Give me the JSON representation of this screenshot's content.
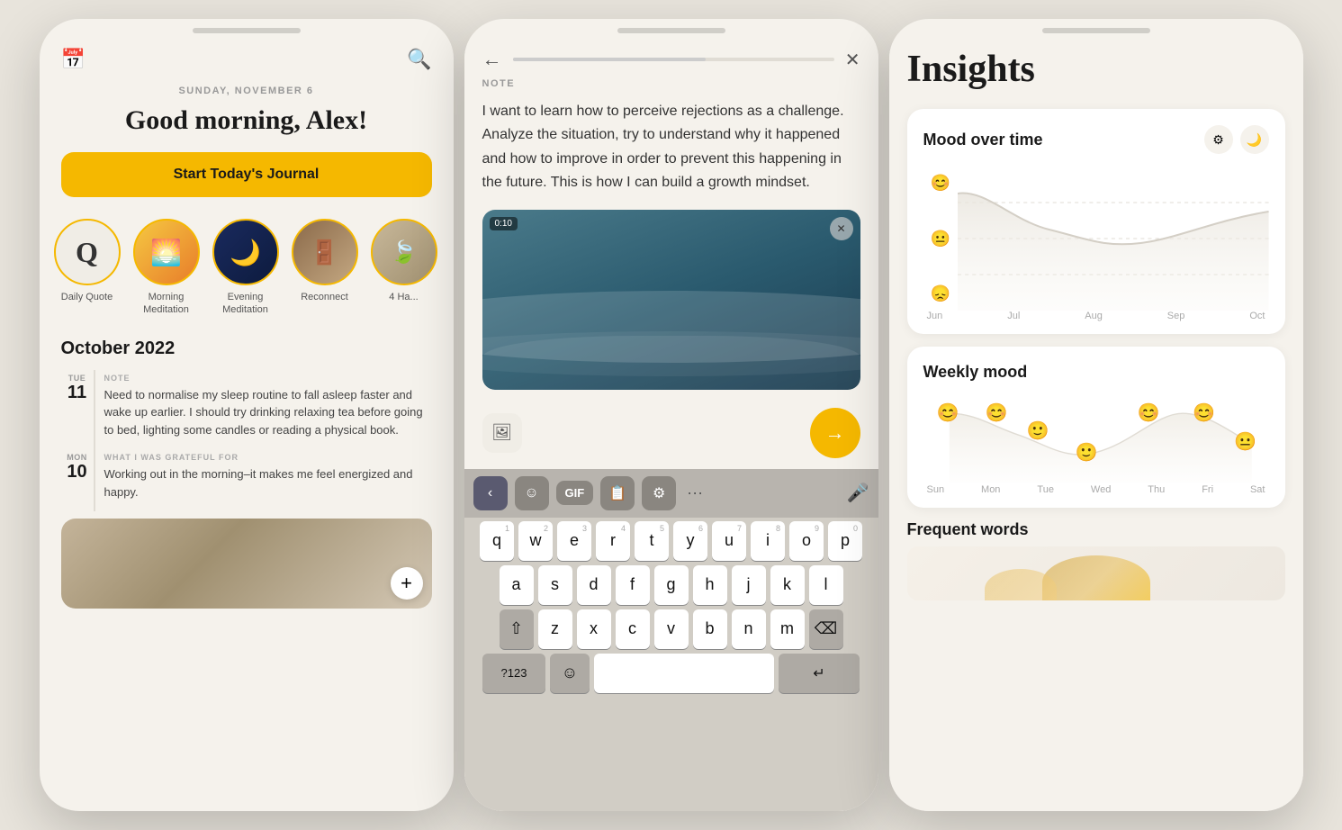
{
  "screen1": {
    "date": "SUNDAY, NOVEMBER 6",
    "greeting": "Good morning, Alex!",
    "cta_button": "Start Today's Journal",
    "circles": [
      {
        "label": "Daily Quote",
        "type": "quote"
      },
      {
        "label": "Morning Meditation",
        "type": "sunrise"
      },
      {
        "label": "Evening Meditation",
        "type": "night"
      },
      {
        "label": "Reconnect",
        "type": "door"
      },
      {
        "label": "4 Ha...",
        "type": "partial"
      }
    ],
    "section_title": "October 2022",
    "entries": [
      {
        "day_name": "TUE",
        "day_num": "11",
        "tag": "NOTE",
        "text": "Need to normalise my sleep routine to fall asleep faster and wake up earlier. I should try drinking relaxing tea before going to bed, lighting some candles or reading a physical book."
      },
      {
        "day_name": "MON",
        "day_num": "10",
        "tag": "WHAT I WAS GRATEFUL FOR",
        "text": "Working out in the morning–it makes me feel energized and happy."
      }
    ],
    "add_btn": "+"
  },
  "screen2": {
    "tag": "NOTE",
    "note_text": "I want to learn how to perceive rejections as a challenge. Analyze the situation, try to understand why it happened and how to improve in order to prevent this happening in the future. This is how I can build a growth mindset.",
    "video_time": "0:10",
    "keyboard": {
      "row1": [
        "q",
        "w",
        "e",
        "r",
        "t",
        "y",
        "u",
        "i",
        "o",
        "p"
      ],
      "row1_nums": [
        "1",
        "2",
        "3",
        "4",
        "5",
        "6",
        "7",
        "8",
        "9",
        "0"
      ],
      "row2": [
        "a",
        "s",
        "d",
        "f",
        "g",
        "h",
        "j",
        "k",
        "l"
      ],
      "row3": [
        "z",
        "x",
        "c",
        "v",
        "b",
        "n",
        "m"
      ],
      "special_left": "⇧",
      "special_right": "⌫",
      "bottom_left": "?123",
      "bottom_emoji": "☺",
      "bottom_right": "↵"
    }
  },
  "screen3": {
    "title": "Insights",
    "mood_over_time": {
      "card_title": "Mood over time",
      "x_labels": [
        "Jun",
        "Jul",
        "Aug",
        "Sep",
        "Oct"
      ],
      "emoji_top": "😊",
      "emoji_mid": "😐",
      "emoji_low": "😞"
    },
    "weekly_mood": {
      "card_title": "Weekly mood",
      "x_labels": [
        "Sun",
        "Mon",
        "Tue",
        "Wed",
        "Thu",
        "Fri",
        "Sat"
      ]
    },
    "frequent_words": {
      "title": "Frequent words"
    }
  }
}
